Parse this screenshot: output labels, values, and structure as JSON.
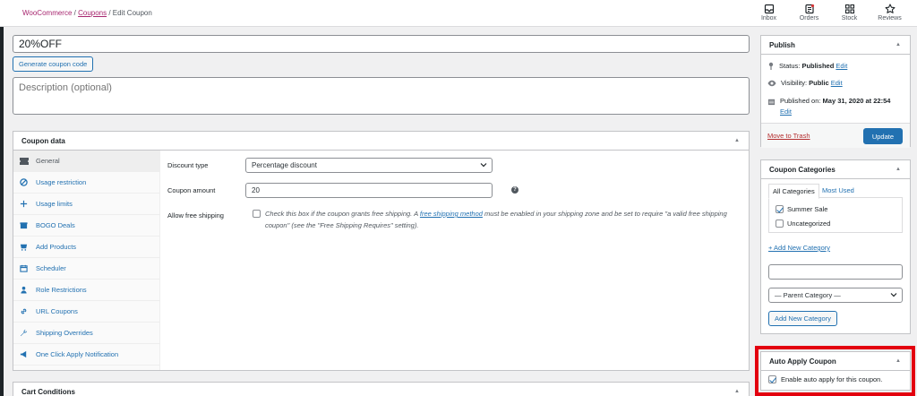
{
  "breadcrumb": {
    "woocommerce": "WooCommerce",
    "sep1": " / ",
    "coupons": "Coupons",
    "sep2": " / ",
    "current": "Edit Coupon"
  },
  "topnav": [
    {
      "label": "Inbox",
      "icon": "inbox-icon"
    },
    {
      "label": "Orders",
      "icon": "orders-icon"
    },
    {
      "label": "Stock",
      "icon": "stock-icon"
    },
    {
      "label": "Reviews",
      "icon": "star-icon"
    }
  ],
  "coupon": {
    "code": "20%OFF",
    "generate_label": "Generate coupon code",
    "description_placeholder": "Description (optional)"
  },
  "coupon_data": {
    "title": "Coupon data",
    "tabs": [
      {
        "label": "General",
        "icon": "ticket-icon"
      },
      {
        "label": "Usage restriction",
        "icon": "block-icon"
      },
      {
        "label": "Usage limits",
        "icon": "plus-icon"
      },
      {
        "label": "BOGO Deals",
        "icon": "bogo-icon"
      },
      {
        "label": "Add Products",
        "icon": "cart-icon"
      },
      {
        "label": "Scheduler",
        "icon": "calendar-icon"
      },
      {
        "label": "Role Restrictions",
        "icon": "user-icon"
      },
      {
        "label": "URL Coupons",
        "icon": "link-icon"
      },
      {
        "label": "Shipping Overrides",
        "icon": "wrench-icon"
      },
      {
        "label": "One Click Apply Notification",
        "icon": "megaphone-icon"
      }
    ],
    "discount_type_label": "Discount type",
    "discount_type_value": "Percentage discount",
    "coupon_amount_label": "Coupon amount",
    "coupon_amount_value": "20",
    "free_shipping_label": "Allow free shipping",
    "free_shipping_text_1": "Check this box if the coupon grants free shipping. A ",
    "free_shipping_link": "free shipping method",
    "free_shipping_text_2": " must be enabled in your shipping zone and be set to require \"a valid free shipping",
    "free_shipping_text_3": "coupon\" (see the \"Free Shipping Requires\" setting)."
  },
  "cart_conditions": {
    "title": "Cart Conditions"
  },
  "publish": {
    "title": "Publish",
    "status_label": "Status: ",
    "status_value": "Published",
    "visibility_label": "Visibility: ",
    "visibility_value": "Public",
    "published_label": "Published on: ",
    "published_value": "May 31, 2020 at 22:54",
    "edit": "Edit",
    "trash": "Move to Trash",
    "update": "Update"
  },
  "categories": {
    "title": "Coupon Categories",
    "tab_all": "All Categories",
    "tab_most": "Most Used",
    "items": [
      {
        "label": "Summer Sale",
        "checked": true
      },
      {
        "label": "Uncategorized",
        "checked": false
      }
    ],
    "add_new_link": "+ Add New Category",
    "parent_placeholder": "— Parent Category —",
    "add_button": "Add New Category"
  },
  "auto_apply": {
    "title": "Auto Apply Coupon",
    "enable_label": "Enable auto apply for this coupon."
  },
  "colors": {
    "link": "#2271b1",
    "primary": "#2271b1",
    "breadcrumb_link": "#a7266f",
    "trash": "#b32d2e",
    "highlight": "#e3000f"
  }
}
